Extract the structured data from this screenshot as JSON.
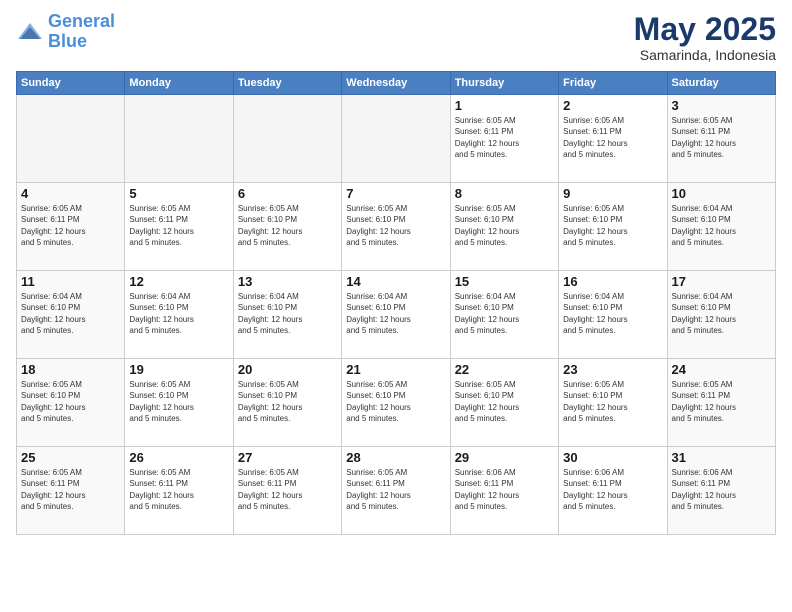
{
  "header": {
    "logo_line1": "General",
    "logo_line2": "Blue",
    "month": "May 2025",
    "location": "Samarinda, Indonesia"
  },
  "weekdays": [
    "Sunday",
    "Monday",
    "Tuesday",
    "Wednesday",
    "Thursday",
    "Friday",
    "Saturday"
  ],
  "weeks": [
    [
      {
        "day": "",
        "info": ""
      },
      {
        "day": "",
        "info": ""
      },
      {
        "day": "",
        "info": ""
      },
      {
        "day": "",
        "info": ""
      },
      {
        "day": "1",
        "info": "Sunrise: 6:05 AM\nSunset: 6:11 PM\nDaylight: 12 hours\nand 5 minutes."
      },
      {
        "day": "2",
        "info": "Sunrise: 6:05 AM\nSunset: 6:11 PM\nDaylight: 12 hours\nand 5 minutes."
      },
      {
        "day": "3",
        "info": "Sunrise: 6:05 AM\nSunset: 6:11 PM\nDaylight: 12 hours\nand 5 minutes."
      }
    ],
    [
      {
        "day": "4",
        "info": "Sunrise: 6:05 AM\nSunset: 6:11 PM\nDaylight: 12 hours\nand 5 minutes."
      },
      {
        "day": "5",
        "info": "Sunrise: 6:05 AM\nSunset: 6:11 PM\nDaylight: 12 hours\nand 5 minutes."
      },
      {
        "day": "6",
        "info": "Sunrise: 6:05 AM\nSunset: 6:10 PM\nDaylight: 12 hours\nand 5 minutes."
      },
      {
        "day": "7",
        "info": "Sunrise: 6:05 AM\nSunset: 6:10 PM\nDaylight: 12 hours\nand 5 minutes."
      },
      {
        "day": "8",
        "info": "Sunrise: 6:05 AM\nSunset: 6:10 PM\nDaylight: 12 hours\nand 5 minutes."
      },
      {
        "day": "9",
        "info": "Sunrise: 6:05 AM\nSunset: 6:10 PM\nDaylight: 12 hours\nand 5 minutes."
      },
      {
        "day": "10",
        "info": "Sunrise: 6:04 AM\nSunset: 6:10 PM\nDaylight: 12 hours\nand 5 minutes."
      }
    ],
    [
      {
        "day": "11",
        "info": "Sunrise: 6:04 AM\nSunset: 6:10 PM\nDaylight: 12 hours\nand 5 minutes."
      },
      {
        "day": "12",
        "info": "Sunrise: 6:04 AM\nSunset: 6:10 PM\nDaylight: 12 hours\nand 5 minutes."
      },
      {
        "day": "13",
        "info": "Sunrise: 6:04 AM\nSunset: 6:10 PM\nDaylight: 12 hours\nand 5 minutes."
      },
      {
        "day": "14",
        "info": "Sunrise: 6:04 AM\nSunset: 6:10 PM\nDaylight: 12 hours\nand 5 minutes."
      },
      {
        "day": "15",
        "info": "Sunrise: 6:04 AM\nSunset: 6:10 PM\nDaylight: 12 hours\nand 5 minutes."
      },
      {
        "day": "16",
        "info": "Sunrise: 6:04 AM\nSunset: 6:10 PM\nDaylight: 12 hours\nand 5 minutes."
      },
      {
        "day": "17",
        "info": "Sunrise: 6:04 AM\nSunset: 6:10 PM\nDaylight: 12 hours\nand 5 minutes."
      }
    ],
    [
      {
        "day": "18",
        "info": "Sunrise: 6:05 AM\nSunset: 6:10 PM\nDaylight: 12 hours\nand 5 minutes."
      },
      {
        "day": "19",
        "info": "Sunrise: 6:05 AM\nSunset: 6:10 PM\nDaylight: 12 hours\nand 5 minutes."
      },
      {
        "day": "20",
        "info": "Sunrise: 6:05 AM\nSunset: 6:10 PM\nDaylight: 12 hours\nand 5 minutes."
      },
      {
        "day": "21",
        "info": "Sunrise: 6:05 AM\nSunset: 6:10 PM\nDaylight: 12 hours\nand 5 minutes."
      },
      {
        "day": "22",
        "info": "Sunrise: 6:05 AM\nSunset: 6:10 PM\nDaylight: 12 hours\nand 5 minutes."
      },
      {
        "day": "23",
        "info": "Sunrise: 6:05 AM\nSunset: 6:10 PM\nDaylight: 12 hours\nand 5 minutes."
      },
      {
        "day": "24",
        "info": "Sunrise: 6:05 AM\nSunset: 6:11 PM\nDaylight: 12 hours\nand 5 minutes."
      }
    ],
    [
      {
        "day": "25",
        "info": "Sunrise: 6:05 AM\nSunset: 6:11 PM\nDaylight: 12 hours\nand 5 minutes."
      },
      {
        "day": "26",
        "info": "Sunrise: 6:05 AM\nSunset: 6:11 PM\nDaylight: 12 hours\nand 5 minutes."
      },
      {
        "day": "27",
        "info": "Sunrise: 6:05 AM\nSunset: 6:11 PM\nDaylight: 12 hours\nand 5 minutes."
      },
      {
        "day": "28",
        "info": "Sunrise: 6:05 AM\nSunset: 6:11 PM\nDaylight: 12 hours\nand 5 minutes."
      },
      {
        "day": "29",
        "info": "Sunrise: 6:06 AM\nSunset: 6:11 PM\nDaylight: 12 hours\nand 5 minutes."
      },
      {
        "day": "30",
        "info": "Sunrise: 6:06 AM\nSunset: 6:11 PM\nDaylight: 12 hours\nand 5 minutes."
      },
      {
        "day": "31",
        "info": "Sunrise: 6:06 AM\nSunset: 6:11 PM\nDaylight: 12 hours\nand 5 minutes."
      }
    ]
  ]
}
